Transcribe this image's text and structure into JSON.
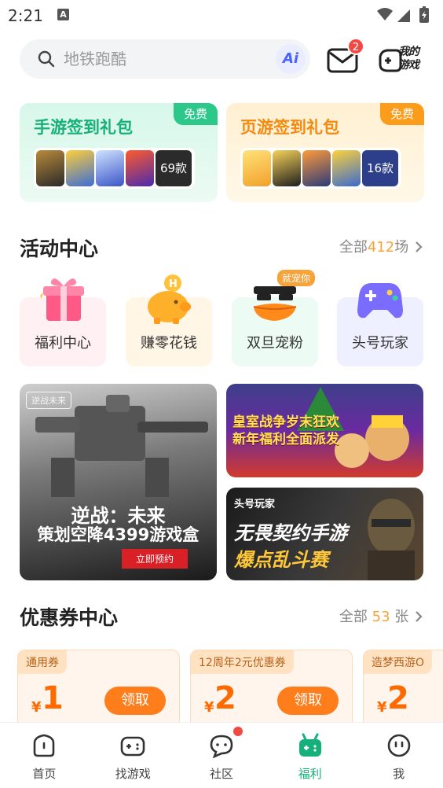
{
  "status_bar": {
    "time": "2:21",
    "notif_letter": "A"
  },
  "search": {
    "placeholder": "地铁跑酷",
    "ai_label": "Ai"
  },
  "header": {
    "mail_badge": "2",
    "my_games_line1": "我的",
    "my_games_line2": "游戏"
  },
  "gift_cards": [
    {
      "title": "手游签到礼包",
      "free_label": "免费",
      "count_label": "69款"
    },
    {
      "title": "页游签到礼包",
      "free_label": "免费",
      "count_label": "16款"
    }
  ],
  "activity": {
    "title": "活动中心",
    "more_prefix": "全部",
    "more_num": "412",
    "more_suffix": "场",
    "tag": "就宠你",
    "items": [
      {
        "label": "福利中心",
        "icon": "gift-icon"
      },
      {
        "label": "赚零花钱",
        "icon": "piggy-bank-icon"
      },
      {
        "label": "双旦宠粉",
        "icon": "duck-sunglasses-icon"
      },
      {
        "label": "头号玩家",
        "icon": "gamepad-icon"
      }
    ]
  },
  "banners": {
    "big": {
      "logo": "逆战未来",
      "line1": "逆战：未来",
      "line2": "策划空降4399游戏盒",
      "cta": "立即预约"
    },
    "red": {
      "line1": "皇室战争岁末狂欢",
      "line2": "新年福利全面派发"
    },
    "dark": {
      "tag": "头号玩家",
      "line1": "无畏契约手游",
      "line2": "爆点乱斗赛"
    }
  },
  "coupons": {
    "title": "优惠券中心",
    "more_prefix": "全部",
    "more_num": "53",
    "more_suffix": "张",
    "items": [
      {
        "tag": "通用券",
        "currency": "¥",
        "amount": "1",
        "button": "领取"
      },
      {
        "tag": "12周年2元优惠券",
        "currency": "¥",
        "amount": "2",
        "button": "领取"
      },
      {
        "tag": "造梦西游O",
        "currency": "¥",
        "amount": "2"
      }
    ]
  },
  "nav": [
    {
      "label": "首页",
      "icon": "home-icon"
    },
    {
      "label": "找游戏",
      "icon": "gamepad-icon"
    },
    {
      "label": "社区",
      "icon": "chat-icon"
    },
    {
      "label": "福利",
      "icon": "gift-box-icon",
      "active": true
    },
    {
      "label": "我",
      "icon": "face-icon"
    }
  ],
  "colors": {
    "accent_green": "#16b07a",
    "accent_orange": "#ff7d1a",
    "badge_red": "#f04a45"
  }
}
